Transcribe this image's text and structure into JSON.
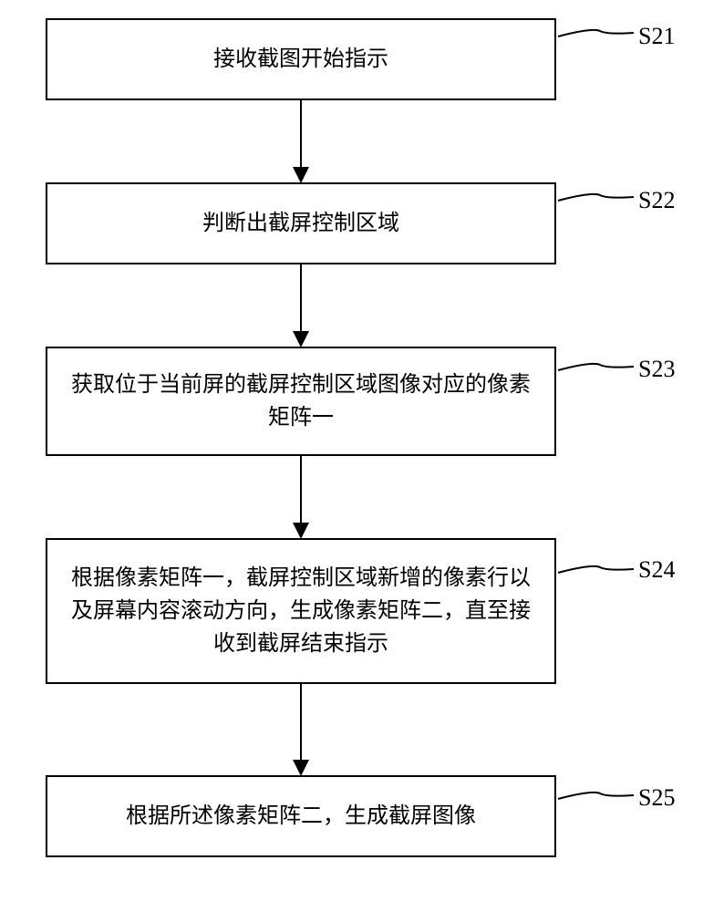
{
  "chart_data": {
    "type": "flowchart",
    "direction": "top-to-bottom",
    "nodes": [
      {
        "id": "S21",
        "label": "接收截图开始指示"
      },
      {
        "id": "S22",
        "label": "判断出截屏控制区域"
      },
      {
        "id": "S23",
        "label": "获取位于当前屏的截屏控制区域图像对应的像素矩阵一"
      },
      {
        "id": "S24",
        "label": "根据像素矩阵一，截屏控制区域新增的像素行以及屏幕内容滚动方向，生成像素矩阵二，直至接收到截屏结束指示"
      },
      {
        "id": "S25",
        "label": "根据所述像素矩阵二，生成截屏图像"
      }
    ],
    "edges": [
      {
        "from": "S21",
        "to": "S22"
      },
      {
        "from": "S22",
        "to": "S23"
      },
      {
        "from": "S23",
        "to": "S24"
      },
      {
        "from": "S24",
        "to": "S25"
      }
    ]
  },
  "steps": {
    "s21": {
      "text": "接收截图开始指示",
      "id": "S21"
    },
    "s22": {
      "text": "判断出截屏控制区域",
      "id": "S22"
    },
    "s23": {
      "text": "获取位于当前屏的截屏控制区域图像对应的像素矩阵一",
      "id": "S23"
    },
    "s24": {
      "text": "根据像素矩阵一，截屏控制区域新增的像素行以及屏幕内容滚动方向，生成像素矩阵二，直至接收到截屏结束指示",
      "id": "S24"
    },
    "s25": {
      "text": "根据所述像素矩阵二，生成截屏图像",
      "id": "S25"
    }
  }
}
